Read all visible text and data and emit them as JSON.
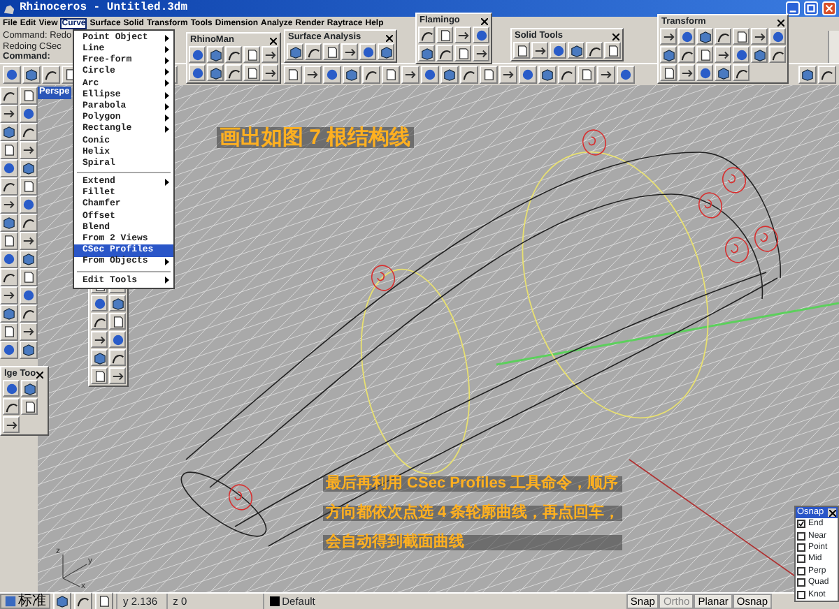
{
  "window": {
    "title": "Rhinoceros - Untitled.3dm"
  },
  "menu_bar": [
    {
      "label": "File",
      "selected": false
    },
    {
      "label": "Edit",
      "selected": false
    },
    {
      "label": "View",
      "selected": false
    },
    {
      "label": "Curve",
      "selected": true
    },
    {
      "label": "Surface",
      "selected": false
    },
    {
      "label": "Solid",
      "selected": false
    },
    {
      "label": "Transform",
      "selected": false
    },
    {
      "label": "Tools",
      "selected": false
    },
    {
      "label": "Dimension",
      "selected": false
    },
    {
      "label": "Analyze",
      "selected": false
    },
    {
      "label": "Render",
      "selected": false
    },
    {
      "label": "Raytrace",
      "selected": false
    },
    {
      "label": "Help",
      "selected": false
    }
  ],
  "command_area": {
    "history": [
      "Command: Redo",
      "Redoing CSec"
    ],
    "prompt": "Command:"
  },
  "curve_menu": {
    "items": [
      {
        "kind": "item",
        "label": "Point Object",
        "submenu": true,
        "selected": false
      },
      {
        "kind": "item",
        "label": "Line",
        "submenu": true,
        "selected": false
      },
      {
        "kind": "item",
        "label": "Free-form",
        "submenu": true,
        "selected": false
      },
      {
        "kind": "item",
        "label": "Circle",
        "submenu": true,
        "selected": false
      },
      {
        "kind": "item",
        "label": "Arc",
        "submenu": true,
        "selected": false
      },
      {
        "kind": "item",
        "label": "Ellipse",
        "submenu": true,
        "selected": false
      },
      {
        "kind": "item",
        "label": "Parabola",
        "submenu": true,
        "selected": false
      },
      {
        "kind": "item",
        "label": "Polygon",
        "submenu": true,
        "selected": false
      },
      {
        "kind": "item",
        "label": "Rectangle",
        "submenu": true,
        "selected": false
      },
      {
        "kind": "item",
        "label": "Conic",
        "submenu": false,
        "selected": false
      },
      {
        "kind": "item",
        "label": "Helix",
        "submenu": false,
        "selected": false
      },
      {
        "kind": "item",
        "label": "Spiral",
        "submenu": false,
        "selected": false
      },
      {
        "kind": "separator"
      },
      {
        "kind": "item",
        "label": "Extend",
        "submenu": true,
        "selected": false
      },
      {
        "kind": "item",
        "label": "Fillet",
        "submenu": false,
        "selected": false
      },
      {
        "kind": "item",
        "label": "Chamfer",
        "submenu": false,
        "selected": false
      },
      {
        "kind": "item",
        "label": "Offset",
        "submenu": false,
        "selected": false
      },
      {
        "kind": "item",
        "label": "Blend",
        "submenu": false,
        "selected": false
      },
      {
        "kind": "item",
        "label": "From 2 Views",
        "submenu": false,
        "selected": false
      },
      {
        "kind": "item",
        "label": "CSec Profiles",
        "submenu": false,
        "selected": true
      },
      {
        "kind": "item",
        "label": "From Objects",
        "submenu": true,
        "selected": false
      },
      {
        "kind": "separator"
      },
      {
        "kind": "item",
        "label": "Edit Tools",
        "submenu": true,
        "selected": false
      }
    ]
  },
  "floating_toolbars": [
    {
      "title": "RhinoMan"
    },
    {
      "title": "Surface Analysis"
    },
    {
      "title": "Flamingo"
    },
    {
      "title": "Solid Tools"
    },
    {
      "title": "Transform"
    },
    {
      "title": "lge Too"
    }
  ],
  "viewport": {
    "tab": "Perspe",
    "axis_labels": [
      "z",
      "y",
      "x"
    ],
    "annotations": [
      {
        "kind": "heading",
        "text": "画出如图 7 根结构线"
      },
      {
        "kind": "note",
        "text": "最后再利用 CSec Profiles 工具命令，顺序"
      },
      {
        "kind": "note",
        "text": "方向都依次点选 4 条轮廓曲线，再点回车，"
      },
      {
        "kind": "note",
        "text": "会自动得到截面曲线"
      }
    ]
  },
  "status_bar": {
    "taskbar_label": "标准",
    "y": "y 2.136",
    "z": "z 0",
    "layer": "Default",
    "toggles": [
      {
        "label": "Snap",
        "disabled": false
      },
      {
        "label": "Ortho",
        "disabled": true
      },
      {
        "label": "Planar",
        "disabled": false
      },
      {
        "label": "Osnap",
        "disabled": false
      }
    ]
  },
  "osnap": {
    "title": "Osnap",
    "options": [
      {
        "label": "End",
        "checked": true
      },
      {
        "label": "Near",
        "checked": false
      },
      {
        "label": "Point",
        "checked": false
      },
      {
        "label": "Mid",
        "checked": false
      },
      {
        "label": "Perp",
        "checked": false
      },
      {
        "label": "Quad",
        "checked": false
      },
      {
        "label": "Knot",
        "checked": false
      }
    ]
  }
}
